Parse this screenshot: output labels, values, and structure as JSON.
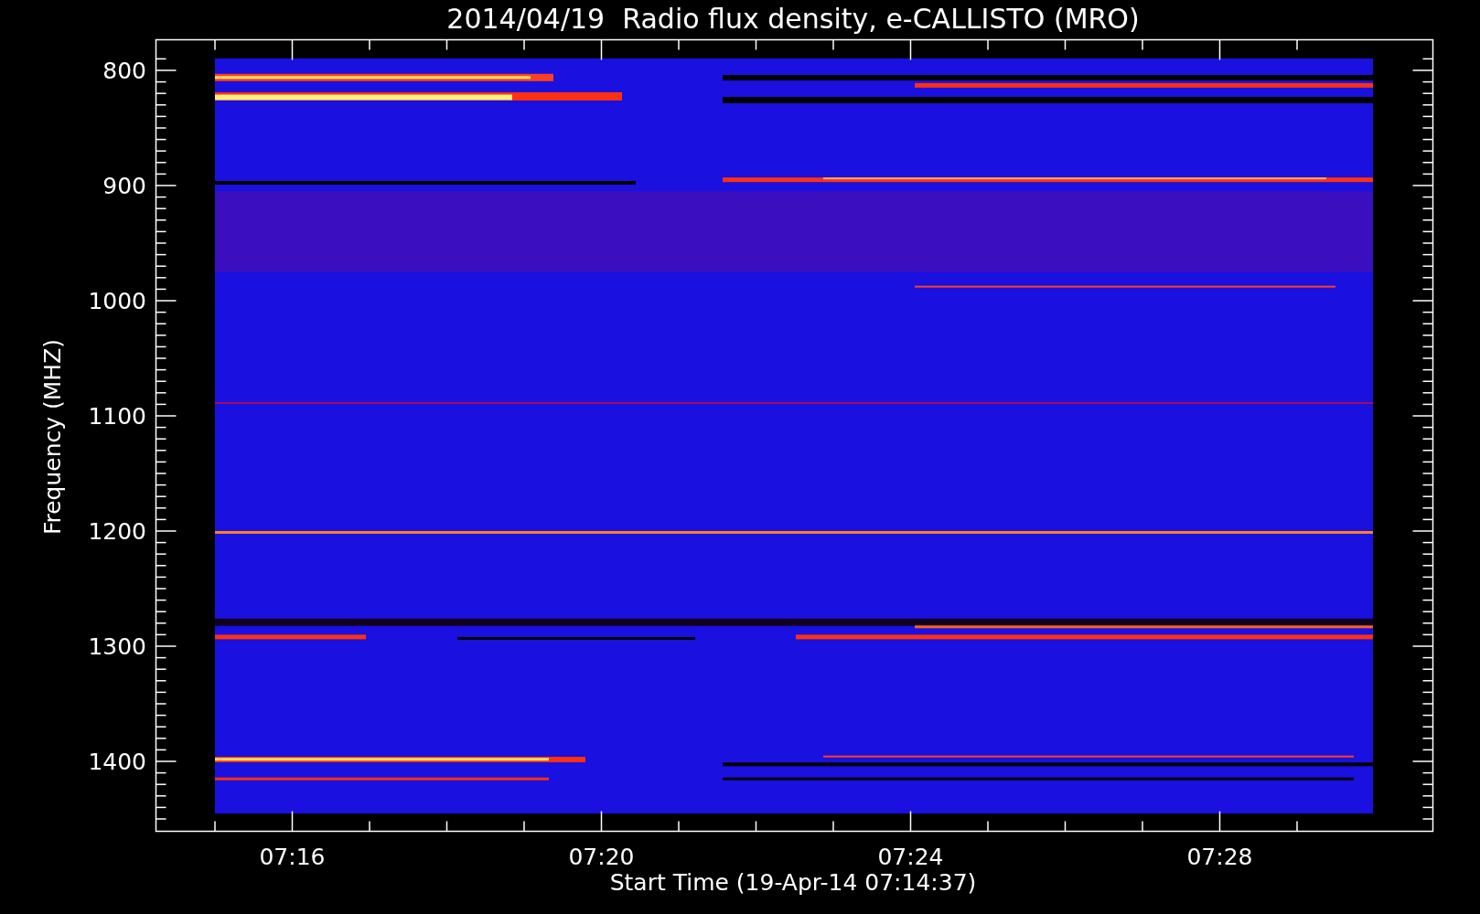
{
  "title": "2014/04/19  Radio flux density, e-CALLISTO (MRO)",
  "ylabel": "Frequency (MHZ)",
  "yticks": [
    "800",
    "900",
    "1000",
    "1100",
    "1200",
    "1300",
    "1400"
  ],
  "xticks": [
    "07:16",
    "07:20",
    "07:24",
    "07:28"
  ],
  "xlabel": "Start Time (19-Apr-14 07:14:37)"
}
